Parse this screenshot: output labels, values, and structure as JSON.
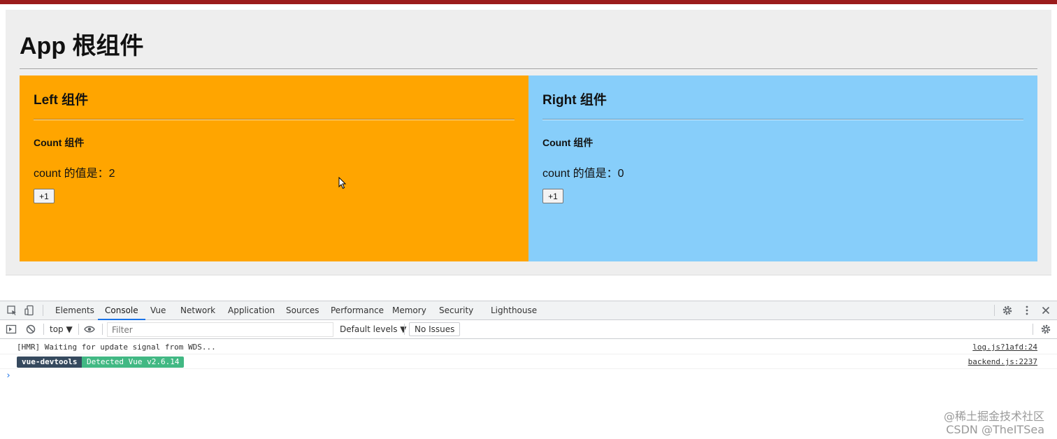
{
  "app": {
    "title": "App 根组件",
    "left": {
      "title": "Left 组件",
      "count_title": "Count 组件",
      "count_text": "count 的值是：2",
      "button_label": "+1"
    },
    "right": {
      "title": "Right 组件",
      "count_title": "Count 组件",
      "count_text": "count 的值是：0",
      "button_label": "+1"
    }
  },
  "colors": {
    "left_panel": "#ffa500",
    "right_panel": "#87cefa",
    "app_bg": "#eeeeee",
    "top_bar": "#9b1c1c",
    "active_tab": "#1a73e8",
    "vue_badge": "#41b883",
    "devtools_badge": "#35495e"
  },
  "devtools": {
    "tabs": [
      "Elements",
      "Console",
      "Vue",
      "Network",
      "Application",
      "Sources",
      "Performance",
      "Memory",
      "Security",
      "Lighthouse"
    ],
    "active_tab": "Console",
    "toolbar": {
      "context": "top ▼",
      "filter_placeholder": "Filter",
      "levels": "Default levels ▼",
      "issues": "No Issues"
    },
    "logs": [
      {
        "text": "[HMR] Waiting for update signal from WDS...",
        "source": "log.js?1afd:24"
      },
      {
        "badge_left": "vue-devtools",
        "badge_right": "Detected Vue v2.6.14",
        "source": "backend.js:2237"
      }
    ],
    "prompt": "›"
  },
  "watermark": {
    "line1": "@稀土掘金技术社区",
    "line2": "CSDN @TheITSea"
  }
}
